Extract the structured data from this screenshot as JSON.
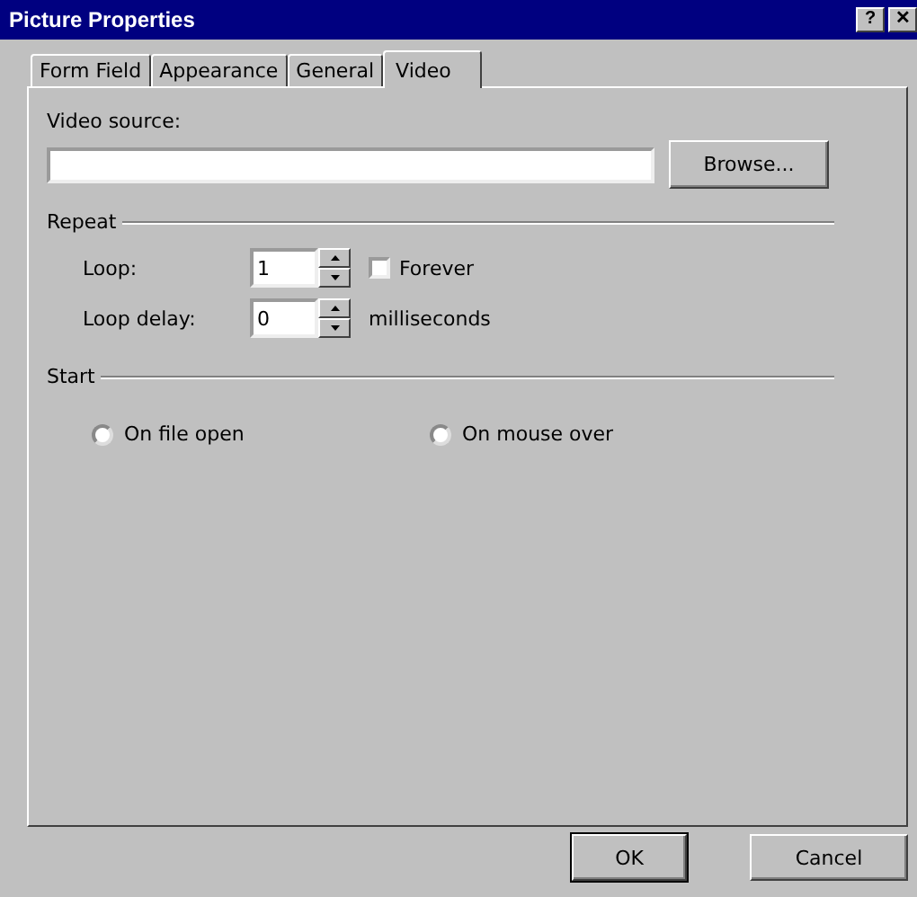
{
  "window": {
    "title": "Picture Properties",
    "help_button": "?",
    "close_button": "✕"
  },
  "tabs": [
    {
      "label": "Form Field",
      "selected": false
    },
    {
      "label": "Appearance",
      "selected": false
    },
    {
      "label": "General",
      "selected": false
    },
    {
      "label": "Video",
      "selected": true
    }
  ],
  "video_source": {
    "label": "Video source:",
    "browse_button": "Browse..."
  },
  "repeat": {
    "heading": "Repeat",
    "loop": {
      "label": "Loop:",
      "value": "1"
    },
    "forever": {
      "label": "Forever",
      "checked": false
    },
    "loop_delay": {
      "label": "Loop delay:",
      "value": "0",
      "unit": "milliseconds"
    }
  },
  "start": {
    "heading": "Start",
    "options": [
      {
        "label": "On file open",
        "selected": false
      },
      {
        "label": "On mouse over",
        "selected": false
      }
    ]
  },
  "buttons": [
    {
      "label": "OK",
      "kind": "default"
    },
    {
      "label": "Cancel",
      "kind": "normal"
    }
  ]
}
